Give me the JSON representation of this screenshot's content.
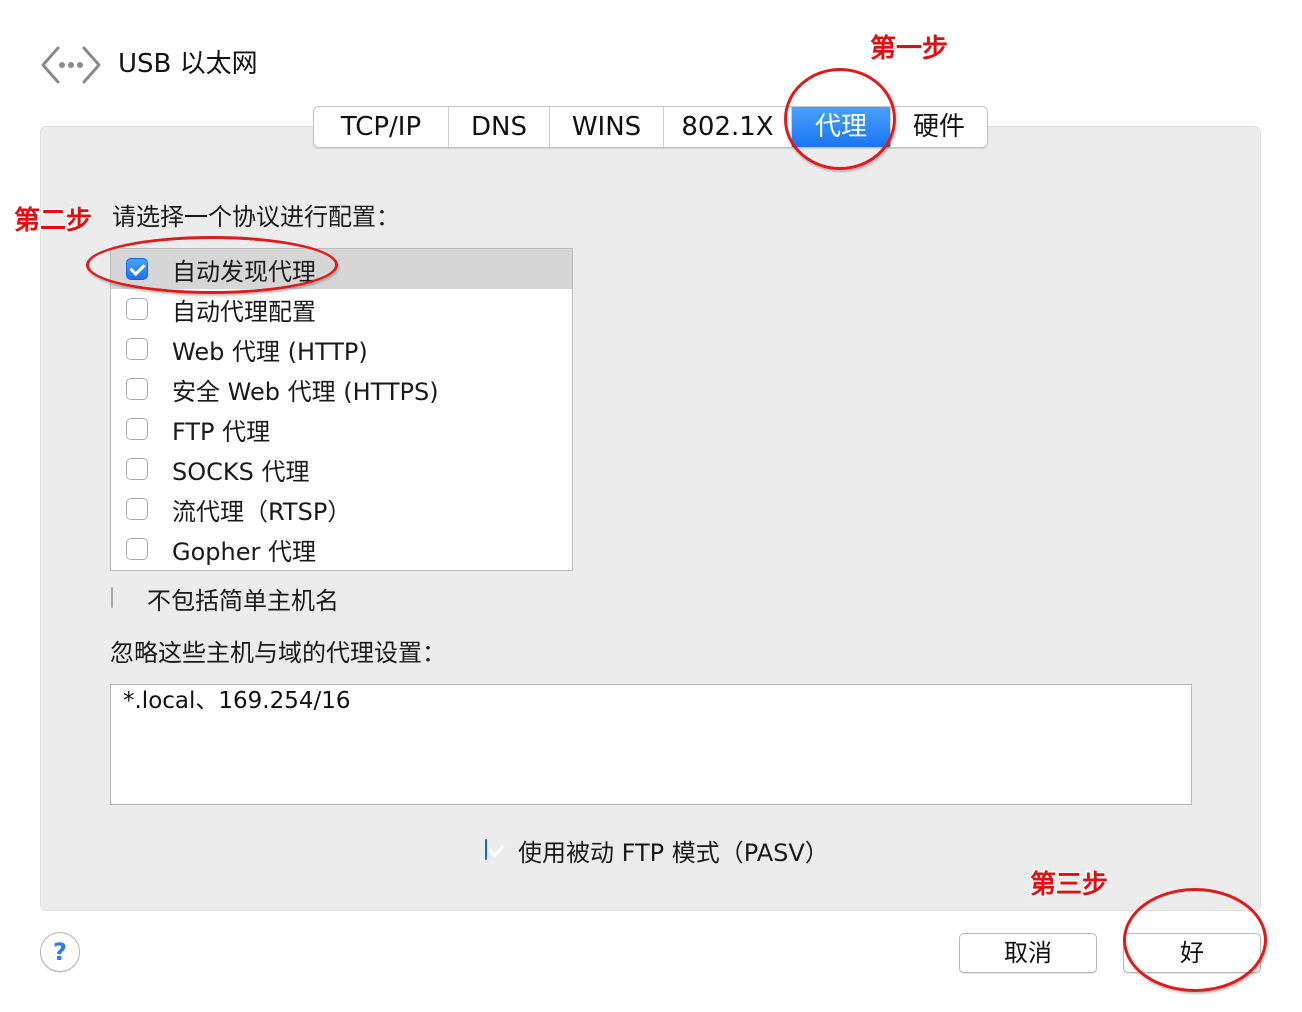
{
  "header": {
    "title": "USB 以太网",
    "icon": "network-arrows-icon"
  },
  "tabs": [
    {
      "label": "TCP/IP",
      "active": false
    },
    {
      "label": "DNS",
      "active": false
    },
    {
      "label": "WINS",
      "active": false
    },
    {
      "label": "802.1X",
      "active": false
    },
    {
      "label": "代理",
      "active": true
    },
    {
      "label": "硬件",
      "active": false
    }
  ],
  "protocols": {
    "heading": "请选择一个协议进行配置：",
    "items": [
      {
        "label": "自动发现代理",
        "checked": true,
        "selected": true
      },
      {
        "label": "自动代理配置",
        "checked": false,
        "selected": false
      },
      {
        "label": "Web 代理 (HTTP)",
        "checked": false,
        "selected": false
      },
      {
        "label": "安全 Web 代理 (HTTPS)",
        "checked": false,
        "selected": false
      },
      {
        "label": "FTP 代理",
        "checked": false,
        "selected": false
      },
      {
        "label": "SOCKS 代理",
        "checked": false,
        "selected": false
      },
      {
        "label": "流代理（RTSP）",
        "checked": false,
        "selected": false
      },
      {
        "label": "Gopher 代理",
        "checked": false,
        "selected": false
      }
    ]
  },
  "exclude_simple": {
    "label": "不包括简单主机名",
    "checked": false
  },
  "bypass": {
    "label": "忽略这些主机与域的代理设置：",
    "value": "*.local、169.254/16"
  },
  "passive_ftp": {
    "label": "使用被动 FTP 模式（PASV）",
    "checked": true
  },
  "buttons": {
    "help": "?",
    "cancel": "取消",
    "ok": "好"
  },
  "annotations": {
    "step1": "第一步",
    "step2": "第二步",
    "step3": "第三步",
    "color": "#e01010"
  }
}
